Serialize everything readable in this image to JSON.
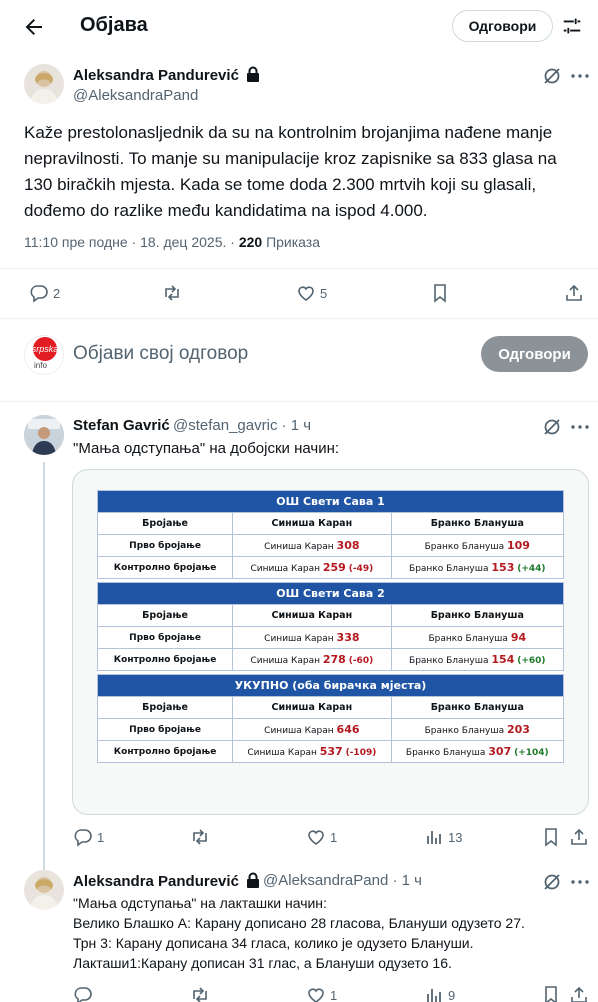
{
  "header": {
    "title": "Објава",
    "reply_label": "Одговори"
  },
  "post": {
    "author_name": "Aleksandra Pandurević",
    "author_handle": "@AleksandraPand",
    "text": "Kaže prestolonasljednik da su na kontrolnim brojanjima nađene manje nepravilnosti. To manje su manipulacije kroz zapisnike sa 833 glasa na 130 biračkih mjesta. Kada se tome doda 2.300 mrtvih koji su glasali, dođemo do razlike među kandidatima na ispod 4.000.",
    "time": "11:10 пре подне · 18. дец 2025. · ",
    "views_count": "220",
    "views_label": "Приказа",
    "replies": "2",
    "likes": "5"
  },
  "compose": {
    "avatar_text_1": "srpska",
    "avatar_text_2": "info",
    "placeholder": "Објави свој одговор",
    "button": "Одговори"
  },
  "reply1": {
    "author_name": "Stefan Gavrić",
    "author_meta": "@stefan_gavric · 1 ч",
    "text": "\"Мања одступања\" на добојски начин:",
    "replies": "1",
    "likes": "1",
    "views": "13"
  },
  "vote_tables": [
    {
      "title": "ОШ Свети Сава 1",
      "headers": [
        "Бројање",
        "Синиша Каран",
        "Бранко Блануша"
      ],
      "rows": [
        {
          "label": "Прво бројање",
          "a_name": "Синиша Каран",
          "a_val": "308",
          "a_diff": "",
          "b_name": "Бранко Блануша",
          "b_val": "109",
          "b_diff": ""
        },
        {
          "label": "Контролно бројање",
          "a_name": "Синиша Каран",
          "a_val": "259",
          "a_diff": "(-49)",
          "b_name": "Бранко Блануша",
          "b_val": "153",
          "b_diff": "(+44)"
        }
      ]
    },
    {
      "title": "ОШ Свети Сава 2",
      "headers": [
        "Бројање",
        "Синиша Каран",
        "Бранко Блануша"
      ],
      "rows": [
        {
          "label": "Прво бројање",
          "a_name": "Синиша Каран",
          "a_val": "338",
          "a_diff": "",
          "b_name": "Бранко Блануша",
          "b_val": "94",
          "b_diff": ""
        },
        {
          "label": "Контролно бројање",
          "a_name": "Синиша Каран",
          "a_val": "278",
          "a_diff": "(-60)",
          "b_name": "Бранко Блануша",
          "b_val": "154",
          "b_diff": "(+60)"
        }
      ]
    },
    {
      "title": "УКУПНО (оба бирачка мјеста)",
      "headers": [
        "Бројање",
        "Синиша Каран",
        "Бранко Блануша"
      ],
      "rows": [
        {
          "label": "Прво бројање",
          "a_name": "Синиша Каран",
          "a_val": "646",
          "a_diff": "",
          "b_name": "Бранко Блануша",
          "b_val": "203",
          "b_diff": ""
        },
        {
          "label": "Контролно бројање",
          "a_name": "Синиша Каран",
          "a_val": "537",
          "a_diff": "(-109)",
          "b_name": "Бранко Блануша",
          "b_val": "307",
          "b_diff": "(+104)"
        }
      ]
    }
  ],
  "reply2": {
    "author_name": "Aleksandra Pandurević",
    "author_meta": "@AleksandraPand · 1 ч",
    "lines": [
      "\"Мања одступања\" на лакташки начин:",
      "Велико Блашко А: Карану дописано 28 гласова, Блануши одузето 27.",
      "Трн 3: Карану дописана 34 гласа, колико је одузето Блануши.",
      "Лакташи1:Карану дописан 31 глас, а Блануши одузето 16."
    ],
    "likes": "1",
    "views": "9"
  },
  "colors": {
    "accent_red": "#b3191f",
    "accent_green": "#1f7a2a",
    "table_header": "#1f55a4",
    "muted": "#536471"
  }
}
